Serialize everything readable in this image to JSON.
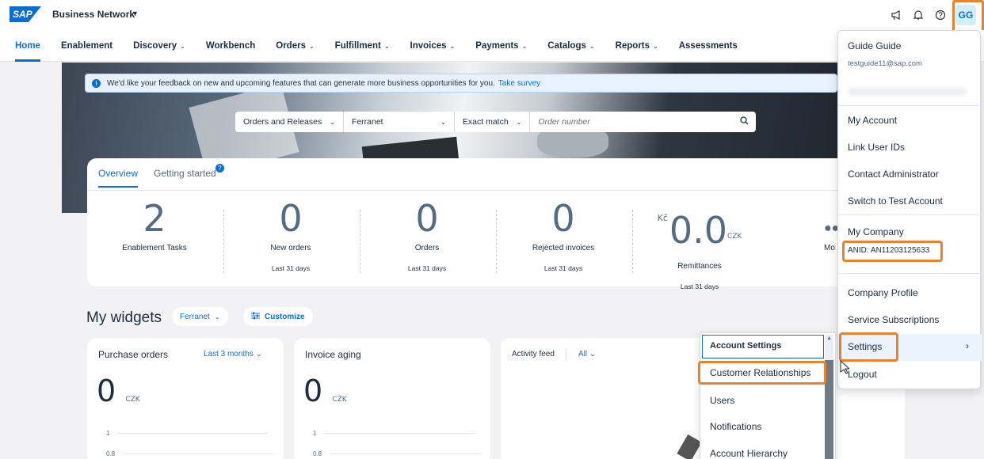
{
  "shell": {
    "logo": "SAP",
    "product": "Business Network",
    "avatar": "GG"
  },
  "nav": {
    "items": [
      {
        "label": "Home",
        "caret": false
      },
      {
        "label": "Enablement",
        "caret": false
      },
      {
        "label": "Discovery",
        "caret": true
      },
      {
        "label": "Workbench",
        "caret": false
      },
      {
        "label": "Orders",
        "caret": true
      },
      {
        "label": "Fulfillment",
        "caret": true
      },
      {
        "label": "Invoices",
        "caret": true
      },
      {
        "label": "Payments",
        "caret": true
      },
      {
        "label": "Catalogs",
        "caret": true
      },
      {
        "label": "Reports",
        "caret": true
      },
      {
        "label": "Assessments",
        "caret": false
      }
    ]
  },
  "feedback": {
    "text": "We'd like your feedback on new and upcoming features that can generate more business opportunities for you.",
    "link": "Take survey"
  },
  "search": {
    "type": "Orders and Releases",
    "customer": "Ferranet",
    "match": "Exact match",
    "placeholder": "Order number"
  },
  "overview": {
    "tabs": [
      "Overview",
      "Getting started"
    ],
    "badge": "?",
    "kpis": [
      {
        "value": "2",
        "label": "Enablement Tasks",
        "sub": ""
      },
      {
        "value": "0",
        "label": "New orders",
        "sub": "Last 31 days"
      },
      {
        "value": "0",
        "label": "Orders",
        "sub": "Last 31 days"
      },
      {
        "value": "0",
        "label": "Rejected invoices",
        "sub": "Last 31 days"
      },
      {
        "value": "0.0",
        "currency": "Kč",
        "unit": "CZK",
        "label": "Remittances",
        "sub": "Last 31 days"
      }
    ],
    "more_label": "Mo"
  },
  "widgets": {
    "title": "My widgets",
    "filter": "Ferranet",
    "customize": "Customize",
    "cards": [
      {
        "title": "Purchase orders",
        "action": "Last 3 months",
        "value": "0",
        "unit": "CZK",
        "ticks": [
          "1",
          "0.8"
        ]
      },
      {
        "title": "Invoice aging",
        "value": "0",
        "unit": "CZK",
        "ticks": [
          "1",
          "0.8"
        ]
      },
      {
        "title": "Activity feed",
        "filter": "All"
      }
    ]
  },
  "menu": {
    "name": "Guide Guide",
    "email": "testguide11@sap.com",
    "items": [
      "My Account",
      "Link User IDs",
      "Contact Administrator",
      "Switch to Test Account"
    ],
    "company_heading": "My Company",
    "anid": "ANID: AN11203125633",
    "company_items": [
      "Company Profile",
      "Service Subscriptions"
    ],
    "settings": "Settings",
    "logout": "Logout"
  },
  "submenu": {
    "items": [
      "Account Settings",
      "Customer Relationships",
      "Users",
      "Notifications",
      "Account Hierarchy"
    ]
  },
  "colors": {
    "accent": "#0a6ed1",
    "highlight": "#e9822e"
  }
}
